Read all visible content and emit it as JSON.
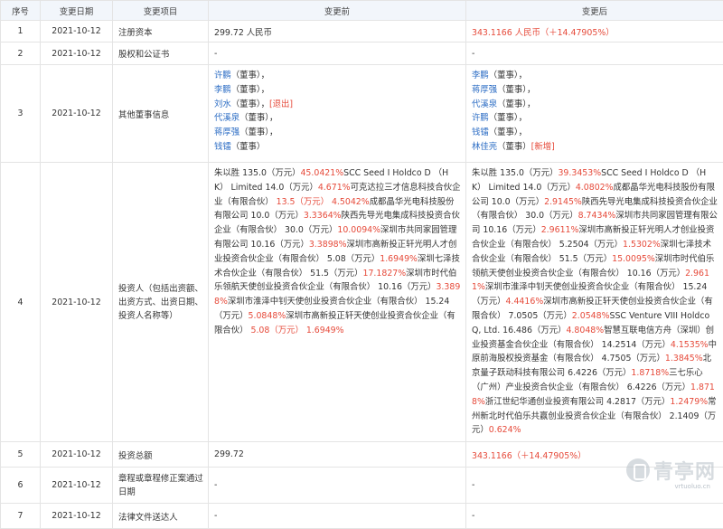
{
  "headers": [
    "序号",
    "变更日期",
    "变更项目",
    "变更前",
    "变更后"
  ],
  "rows": [
    {
      "no": "1",
      "date": "2021-10-12",
      "item": "注册资本",
      "before": "299.72 人民币",
      "after": "343.1166 人民币（＋14.47905%）"
    },
    {
      "no": "2",
      "date": "2021-10-12",
      "item": "股权和公证书",
      "before": "-",
      "after": "-"
    },
    {
      "no": "3",
      "date": "2021-10-12",
      "item": "其他董事信息",
      "before_list": [
        {
          "name": "许鹏",
          "role": "（董事），",
          "tag": ""
        },
        {
          "name": "李鹏",
          "role": "（董事），",
          "tag": ""
        },
        {
          "name": "刘水",
          "role": "（董事），",
          "tag": "[退出]"
        },
        {
          "name": "代溪泉",
          "role": "（董事），",
          "tag": ""
        },
        {
          "name": "蒋厚强",
          "role": "（董事），",
          "tag": ""
        },
        {
          "name": "钱镭",
          "role": "（董事）",
          "tag": ""
        }
      ],
      "after_list": [
        {
          "name": "李鹏",
          "role": "（董事），",
          "tag": ""
        },
        {
          "name": "蒋厚强",
          "role": "（董事），",
          "tag": ""
        },
        {
          "name": "代溪泉",
          "role": "（董事），",
          "tag": ""
        },
        {
          "name": "许鹏",
          "role": "（董事），",
          "tag": ""
        },
        {
          "name": "钱镭",
          "role": "（董事），",
          "tag": ""
        },
        {
          "name": "林佳亮",
          "role": "（董事）",
          "tag": "[新增]"
        }
      ]
    },
    {
      "no": "4",
      "date": "2021-10-12",
      "item": "投资人（包括出资额、出资方式、出资日期、投资人名称等）",
      "before_segments": [
        {
          "t": "朱以胜 135.0（万元）",
          "h": false
        },
        {
          "t": "45.0421%",
          "h": true
        },
        {
          "t": "SCC Seed I Holdco D （HK） Limited 14.0（万元）",
          "h": false
        },
        {
          "t": "4.671%",
          "h": true
        },
        {
          "t": "可克达拉三才信息科技合伙企业（有限合伙） ",
          "h": false
        },
        {
          "t": "13.5（万元）",
          "h": true
        },
        {
          "t": " ",
          "h": false
        },
        {
          "t": "4.5042%",
          "h": true
        },
        {
          "t": "成都晶华光电科技股份有限公司 10.0（万元）",
          "h": false
        },
        {
          "t": "3.3364%",
          "h": true
        },
        {
          "t": "陕西先导光电集成科技投资合伙企业（有限合伙） 30.0（万元）",
          "h": false
        },
        {
          "t": "10.0094%",
          "h": true
        },
        {
          "t": "深圳市共同家园管理有限公司 10.16（万元）",
          "h": false
        },
        {
          "t": "3.3898%",
          "h": true
        },
        {
          "t": "深圳市高新投正轩光明人才创业投资合伙企业（有限合伙） 5.08（万元）",
          "h": false
        },
        {
          "t": "1.6949%",
          "h": true
        },
        {
          "t": "深圳七泽技术合伙企业（有限合伙） 51.5（万元）",
          "h": false
        },
        {
          "t": "17.1827%",
          "h": true
        },
        {
          "t": "深圳市时代伯乐领航天使创业投资合伙企业（有限合伙） 10.16（万元）",
          "h": false
        },
        {
          "t": "3.3898%",
          "h": true
        },
        {
          "t": "深圳市淮泽中钊天使创业投资合伙企业（有限合伙） 15.24（万元）",
          "h": false
        },
        {
          "t": "5.0848%",
          "h": true
        },
        {
          "t": "深圳市高新投正轩天使创业投资合伙企业（有限合伙） ",
          "h": false
        },
        {
          "t": "5.08（万元）",
          "h": true
        },
        {
          "t": " ",
          "h": false
        },
        {
          "t": "1.6949%",
          "h": true
        }
      ],
      "after_segments": [
        {
          "t": "朱以胜 135.0（万元）",
          "h": false
        },
        {
          "t": "39.3453%",
          "h": true
        },
        {
          "t": "SCC Seed I Holdco D （HK） Limited 14.0（万元）",
          "h": false
        },
        {
          "t": "4.0802%",
          "h": true
        },
        {
          "t": "成都晶华光电科技股份有限公司 10.0（万元）",
          "h": false
        },
        {
          "t": "2.9145%",
          "h": true
        },
        {
          "t": "陕西先导光电集成科技投资合伙企业（有限合伙） 30.0（万元）",
          "h": false
        },
        {
          "t": "8.7434%",
          "h": true
        },
        {
          "t": "深圳市共同家园管理有限公司 10.16（万元）",
          "h": false
        },
        {
          "t": "2.9611%",
          "h": true
        },
        {
          "t": "深圳市高新投正轩光明人才创业投资合伙企业（有限合伙） 5.2504（万元）",
          "h": false
        },
        {
          "t": "1.5302%",
          "h": true
        },
        {
          "t": "深圳七泽技术合伙企业（有限合伙） 51.5（万元）",
          "h": false
        },
        {
          "t": "15.0095%",
          "h": true
        },
        {
          "t": "深圳市时代伯乐领航天使创业投资合伙企业（有限合伙） 10.16（万元）",
          "h": false
        },
        {
          "t": "2.9611%",
          "h": true
        },
        {
          "t": "深圳市淮泽中钊天使创业投资合伙企业（有限合伙） 15.24（万元）",
          "h": false
        },
        {
          "t": "4.4416%",
          "h": true
        },
        {
          "t": "深圳市高新投正轩天使创业投资合伙企业（有限合伙） 7.0505（万元）",
          "h": false
        },
        {
          "t": "2.0548%",
          "h": true
        },
        {
          "t": "SSC Venture VIII Holdco Q, Ltd. 16.486（万元）",
          "h": false
        },
        {
          "t": "4.8048%",
          "h": true
        },
        {
          "t": "智慧互联电信方舟（深圳）创业投资基金合伙企业（有限合伙） 14.2514（万元）",
          "h": false
        },
        {
          "t": "4.1535%",
          "h": true
        },
        {
          "t": "中原前海股权投资基金（有限合伙） 4.7505（万元）",
          "h": false
        },
        {
          "t": "1.3845%",
          "h": true
        },
        {
          "t": "北京量子跃动科技有限公司 6.4226（万元）",
          "h": false
        },
        {
          "t": "1.8718%",
          "h": true
        },
        {
          "t": "三七乐心（广州）产业投资合伙企业（有限合伙） 6.4226（万元）",
          "h": false
        },
        {
          "t": "1.8718%",
          "h": true
        },
        {
          "t": "浙江世纪华通创业投资有限公司 4.2817（万元）",
          "h": false
        },
        {
          "t": "1.2479%",
          "h": true
        },
        {
          "t": "常州新北时代伯乐共赢创业投资合伙企业（有限合伙） 2.1409（万元）",
          "h": false
        },
        {
          "t": "0.624%",
          "h": true
        }
      ]
    },
    {
      "no": "5",
      "date": "2021-10-12",
      "item": "投资总额",
      "before": "299.72",
      "after": "343.1166（＋14.47905%）"
    },
    {
      "no": "6",
      "date": "2021-10-12",
      "item": "章程或章程修正案通过日期",
      "before": "-",
      "after": "-"
    },
    {
      "no": "7",
      "date": "2021-10-12",
      "item": "法律文件送达人",
      "before": "-",
      "after": "-"
    }
  ],
  "watermark": {
    "text": "青亭网",
    "url": "vrtuoluo.cn"
  }
}
